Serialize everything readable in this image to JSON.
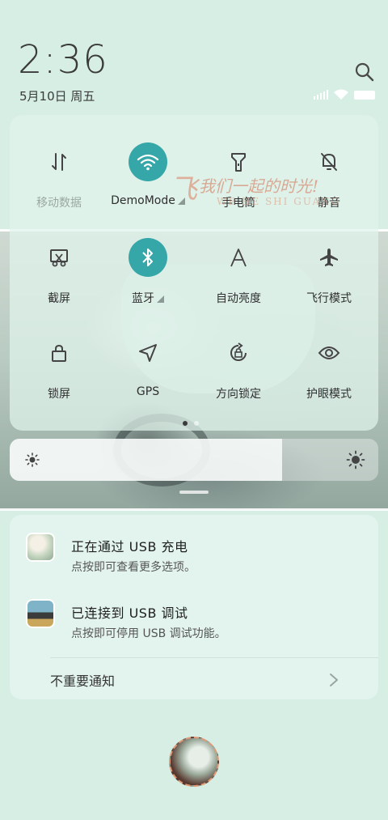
{
  "status": {
    "time": "2:36",
    "date": "5月10日 周五",
    "icons": [
      "signal-icon",
      "wifi-icon",
      "battery-icon"
    ]
  },
  "watermark": {
    "text": "我们一起的时光!",
    "sub": "WE HE SHI GUANG"
  },
  "quick_tiles": [
    {
      "label": "移动数据",
      "icon": "mobile-data-icon",
      "active": false
    },
    {
      "label": "DemoMode",
      "icon": "wifi-icon",
      "active": true
    },
    {
      "label": "手电筒",
      "icon": "flashlight-icon",
      "active": false
    },
    {
      "label": "静音",
      "icon": "mute-bell-icon",
      "active": false
    },
    {
      "label": "截屏",
      "icon": "screenshot-icon",
      "active": false
    },
    {
      "label": "蓝牙",
      "icon": "bluetooth-icon",
      "active": true
    },
    {
      "label": "自动亮度",
      "icon": "auto-brightness-icon",
      "active": false
    },
    {
      "label": "飞行模式",
      "icon": "airplane-icon",
      "active": false
    },
    {
      "label": "锁屏",
      "icon": "lock-icon",
      "active": false
    },
    {
      "label": "GPS",
      "icon": "gps-icon",
      "active": false
    },
    {
      "label": "方向锁定",
      "icon": "rotation-lock-icon",
      "active": false
    },
    {
      "label": "护眼模式",
      "icon": "eye-icon",
      "active": false
    }
  ],
  "pager": {
    "pages": 2,
    "current": 1
  },
  "brightness": {
    "level": 0.74
  },
  "notifications": [
    {
      "title": "正在通过 USB 充电",
      "subtitle": "点按即可查看更多选项。"
    },
    {
      "title": "已连接到 USB 调试",
      "subtitle": "点按即可停用 USB 调试功能。"
    }
  ],
  "unimportant_label": "不重要通知",
  "colors": {
    "accent": "#36a7a8",
    "background": "#d6eee3",
    "watermark": "#d26e50"
  }
}
